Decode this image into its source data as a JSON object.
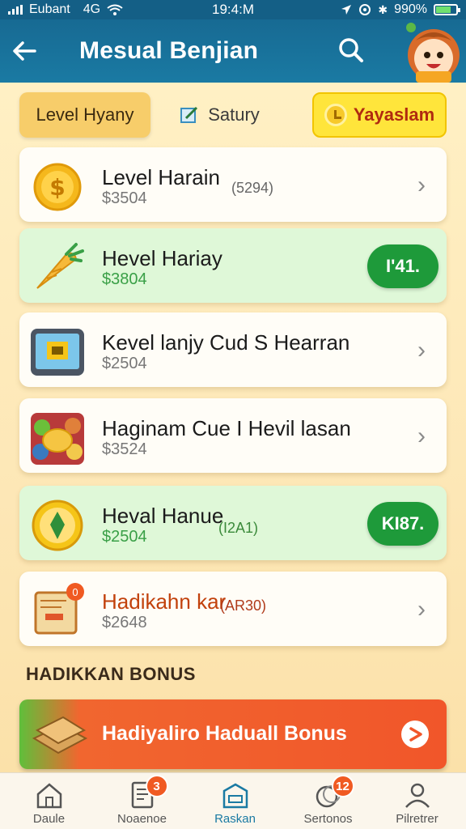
{
  "status_bar": {
    "carrier": "Eubant",
    "network": "4G",
    "time": "19:4:M",
    "battery": "990%"
  },
  "header": {
    "title": "Mesual Benjian",
    "back_icon": "arrow-left-icon",
    "search_icon": "search-icon"
  },
  "filters": {
    "tab1": "Level Hyany",
    "tab2": "Satury",
    "tab3": "Yayaslam"
  },
  "cards": [
    {
      "title": "Level Harain",
      "sub": "$3504",
      "note": "(5294)",
      "action": "chevron"
    },
    {
      "title": "Hevel Hariay",
      "sub": "$3804",
      "note": "",
      "action_label": "I'41."
    },
    {
      "title": "Kevel lanjy  Cud  S Hearran",
      "sub": "$2504",
      "note": "",
      "action": "chevron"
    },
    {
      "title": "Haginam Cue I Hevil lasan",
      "sub": "$3524",
      "note": "",
      "action": "chevron"
    },
    {
      "title": "Heval Hanue",
      "sub": "$2504",
      "note": "(I2A1)",
      "action_label": "KI87."
    },
    {
      "title": "Hadikahn kar",
      "sub": "$2648",
      "note": "(AR30)",
      "action": "chevron",
      "icon_badge": "0"
    }
  ],
  "bonus_section": {
    "heading": "HADIKKAN BONUS",
    "banner_label": "Hadiyaliro Haduall Bonus"
  },
  "bottom_nav": [
    {
      "label": "Daule",
      "icon": "home-icon",
      "badge": ""
    },
    {
      "label": "Noaenoe",
      "icon": "document-icon",
      "badge": "3"
    },
    {
      "label": "Raskan",
      "icon": "store-icon",
      "badge": "",
      "active": true
    },
    {
      "label": "Sertonos",
      "icon": "coins-icon",
      "badge": "12"
    },
    {
      "label": "Pilretrer",
      "icon": "profile-icon",
      "badge": ""
    }
  ],
  "colors": {
    "header": "#176a93",
    "accent_green": "#1e9a3a",
    "accent_orange": "#f1562a",
    "highlight_yellow": "#ffe53b"
  }
}
